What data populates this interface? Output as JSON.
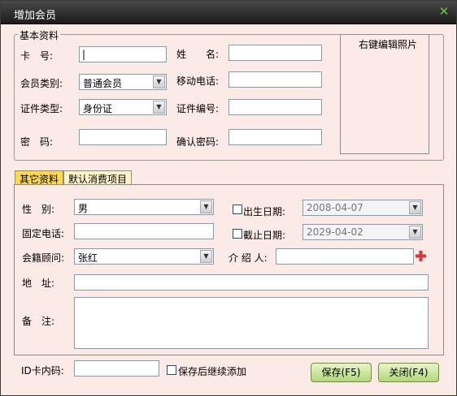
{
  "window": {
    "title": "增加会员",
    "close_glyph": "✕"
  },
  "basic": {
    "legend": "基本资料",
    "card_label": "卡　号:",
    "card_value": "|",
    "name_label": "姓　　名:",
    "name_value": "",
    "member_type_label": "会员类别:",
    "member_type_value": "普通会员",
    "mobile_label": "移动电话:",
    "mobile_value": "",
    "id_type_label": "证件类型:",
    "id_type_value": "身份证",
    "id_no_label": "证件编号:",
    "id_no_value": "",
    "password_label": "密　码:",
    "password_value": "",
    "confirm_label": "确认密码:",
    "confirm_value": "",
    "photo_label": "右键编辑照片"
  },
  "tabs": [
    {
      "label": "其它资料"
    },
    {
      "label": "默认消费项目"
    }
  ],
  "other": {
    "gender_label": "性　别:",
    "gender_value": "男",
    "birth_label": "出生日期:",
    "birth_value": "2008-04-07",
    "phone_label": "固定电话:",
    "phone_value": "",
    "expire_label": "截止日期:",
    "expire_value": "2029-04-02",
    "advisor_label": "会籍顾问:",
    "advisor_value": "张红",
    "referrer_label": "介 绍 人:",
    "referrer_value": "",
    "address_label": "地　址:",
    "address_value": "",
    "remark_label": "备　注:",
    "remark_value": ""
  },
  "footer": {
    "idcard_label": "ID卡内码:",
    "idcard_value": "",
    "continue_label": "保存后继续添加",
    "save_label": "保存(F5)",
    "close_label": "关闭(F4)"
  },
  "colors": {
    "accent_button": "#b3d77a",
    "active_tab": "#ffd84a",
    "plus_icon": "#e0323a",
    "close_icon": "#5fd13a"
  },
  "icons": {
    "plus": "plus-icon",
    "close": "close-icon",
    "dropdown": "chevron-down-icon"
  }
}
